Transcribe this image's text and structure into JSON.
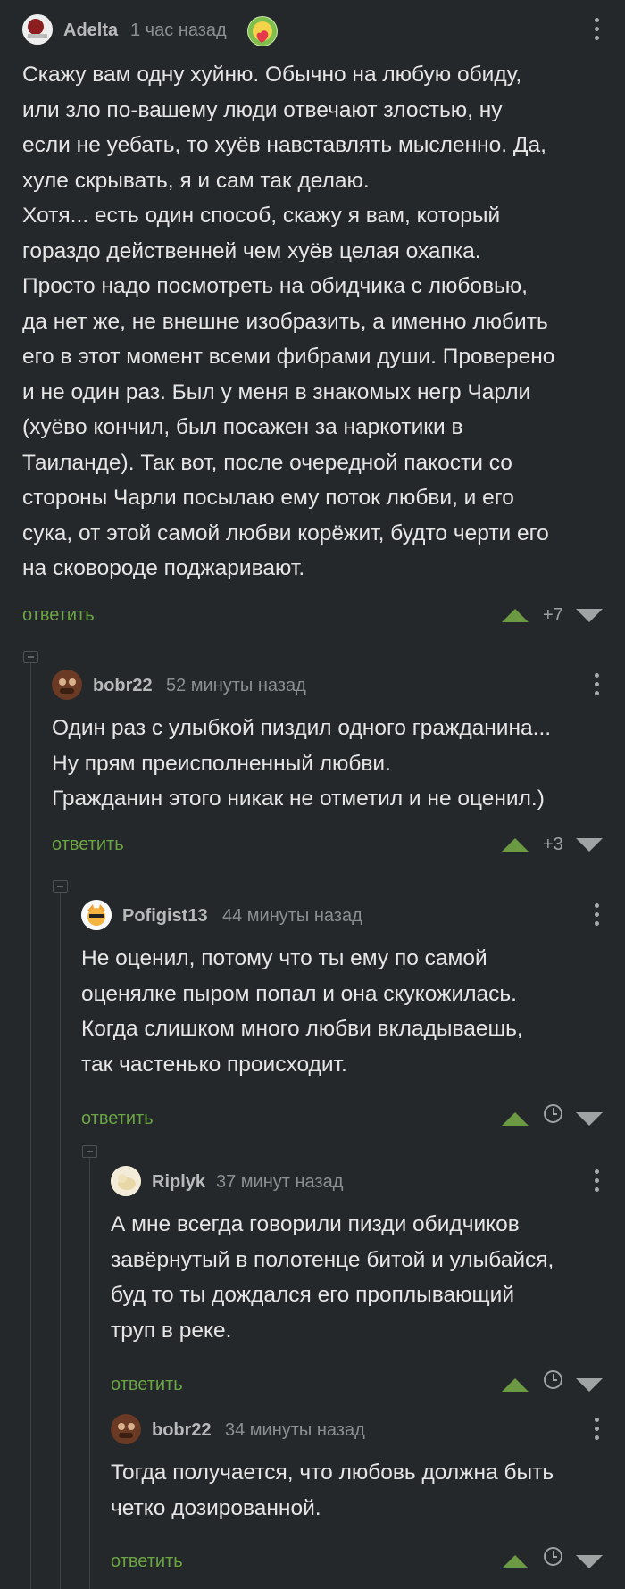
{
  "comments": [
    {
      "author": "Adelta",
      "time": "1 час назад",
      "text": "Скажу вам одну хуйню. Обычно на любую обиду,\nили зло по-вашему люди отвечают злостью, ну\nесли не уебать, то хуёв навставлять мысленно. Да,\nхуле скрывать, я и сам так делаю.\nХотя... есть один способ, скажу я вам, который\nгораздо действенней чем хуёв целая охапка.\nПросто надо посмотреть на обидчика с любовью,\nда нет же, не внешне изобразить, а именно любить\nего в этот момент всеми фибрами души. Проверено\nи не один раз. Был у меня в знакомых негр Чарли\n(хуёво кончил, был посажен за наркотики в\nТаиланде). Так вот, после очередной пакости со\nстороны Чарли посылаю ему поток любви, и его\nсука, от этой самой любви корёжит, будто черти его\nна сковороде поджаривают.",
      "reply": "ответить",
      "score": "+7"
    },
    {
      "author": "bobr22",
      "time": "52 минуты назад",
      "text": "Один раз с улыбкой пиздил одного гражданина...\nНу прям преисполненный любви.\nГражданин этого никак не отметил и не оценил.)",
      "reply": "ответить",
      "score": "+3"
    },
    {
      "author": "Pofigist13",
      "time": "44 минуты назад",
      "text": "Не оценил, потому что ты ему по самой\nоценялке пыром попал и она скукожилась.\nКогда слишком много любви вкладываешь,\nтак частенько происходит.",
      "reply": "ответить"
    },
    {
      "author": "Riplyk",
      "time": "37 минут назад",
      "text": "А мне всегда говорили пизди обидчиков\nзавёрнутый в полотенце битой и улыбайся,\nбуд то ты дождался его проплывающий\nтруп в реке.",
      "reply": "ответить"
    },
    {
      "author": "bobr22",
      "time": "34 минуты назад",
      "text": "Тогда получается, что любовь должна быть\nчетко дозированной.",
      "reply": "ответить"
    }
  ],
  "colors": {
    "background": "#25282a",
    "text": "#e6e6e6",
    "reply_link": "#6aa443",
    "upvote": "#6c9a42",
    "muted": "#8c8f91"
  },
  "icons": [
    "more-vertical-icon",
    "upvote-icon",
    "downvote-icon",
    "clock-icon",
    "collapse-icon",
    "community-badge-icon"
  ]
}
